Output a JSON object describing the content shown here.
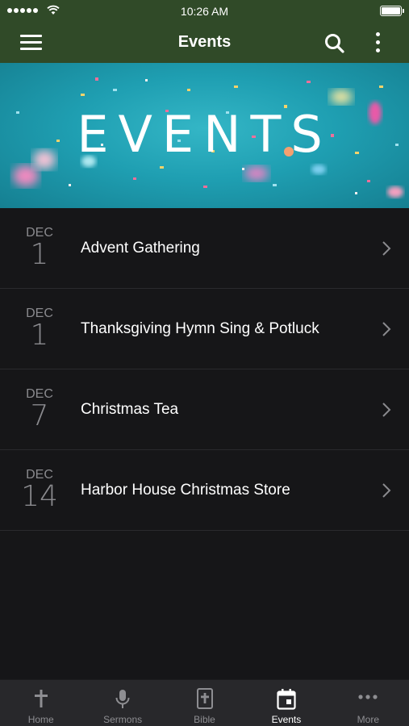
{
  "status_bar": {
    "time": "10:26 AM"
  },
  "nav": {
    "title": "Events"
  },
  "banner": {
    "title": "EVENTS"
  },
  "events": [
    {
      "month": "DEC",
      "day": "1",
      "name": "Advent Gathering"
    },
    {
      "month": "DEC",
      "day": "1",
      "name": "Thanksgiving Hymn Sing & Potluck"
    },
    {
      "month": "DEC",
      "day": "7",
      "name": "Christmas Tea"
    },
    {
      "month": "DEC",
      "day": "14",
      "name": "Harbor House Christmas Store"
    }
  ],
  "tabs": [
    {
      "label": "Home",
      "icon": "cross-icon"
    },
    {
      "label": "Sermons",
      "icon": "microphone-icon"
    },
    {
      "label": "Bible",
      "icon": "bible-icon"
    },
    {
      "label": "Events",
      "icon": "calendar-icon",
      "active": true
    },
    {
      "label": "More",
      "icon": "ellipsis-icon"
    }
  ],
  "colors": {
    "header": "#304a28",
    "background": "#161618",
    "tab_bar": "#28282b",
    "banner": "#1f9fb2"
  }
}
